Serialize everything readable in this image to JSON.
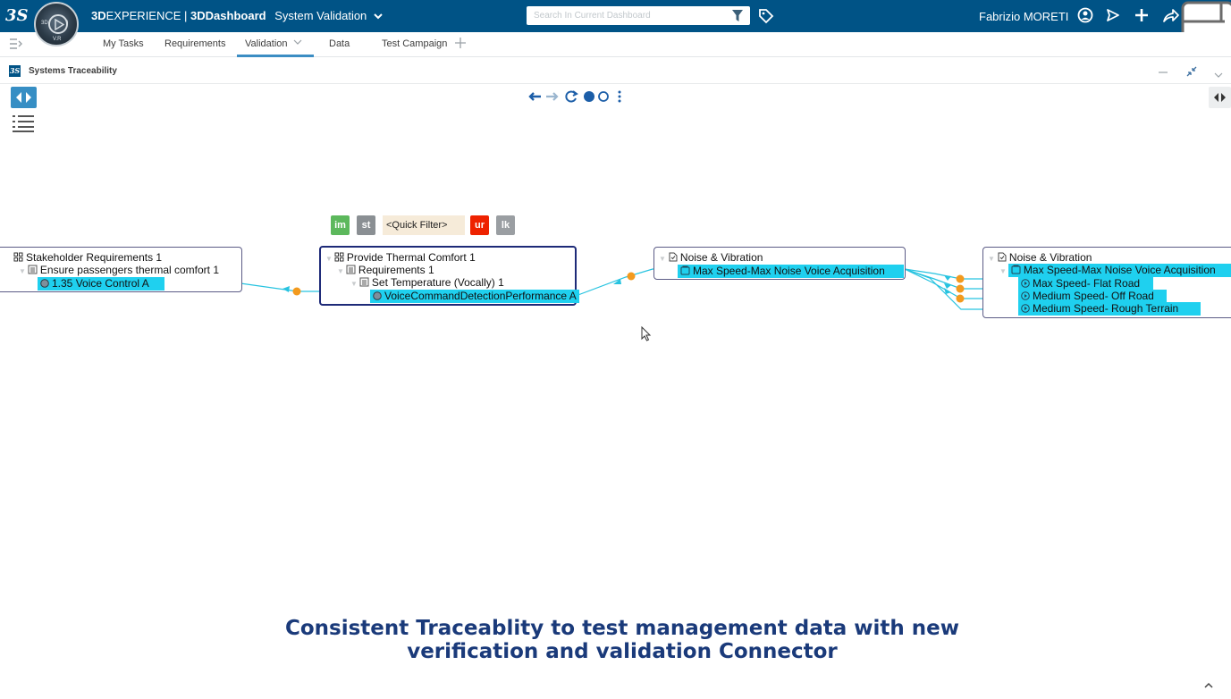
{
  "topbar": {
    "brand_prefix": "3D",
    "brand_experience": "EXPERIENCE",
    "brand_sep": " | ",
    "brand_dashboard": "3DDashboard",
    "dashboard_name": "System Validation",
    "search_placeholder": "Search In Current Dashboard",
    "username": "Fabrizio MORETI",
    "compass_v": "V.R",
    "compass_3d": "3D",
    "compass_i": "i"
  },
  "tabs": {
    "items": [
      {
        "label": "My Tasks"
      },
      {
        "label": "Requirements"
      },
      {
        "label": "Validation"
      },
      {
        "label": "Data"
      },
      {
        "label": "Test Campaign"
      }
    ]
  },
  "widget": {
    "title": "Systems Traceability"
  },
  "quick_filter": {
    "chips": [
      {
        "label": "im",
        "color": "#5cb85c"
      },
      {
        "label": "st",
        "color": "#8a8f93"
      },
      {
        "label": "ur",
        "color": "#ee2200"
      },
      {
        "label": "lk",
        "color": "#9a9ea2"
      }
    ],
    "placeholder": "<Quick Filter>"
  },
  "nodes": {
    "stakeholder": {
      "title": "Stakeholder Requirements 1",
      "child": "Ensure passengers thermal comfort 1",
      "leaf": "1.35 Voice Control A"
    },
    "thermal": {
      "title": "Provide Thermal Comfort 1",
      "child": "Requirements 1",
      "grandchild": "Set Temperature (Vocally) 1",
      "leaf": "VoiceCommandDetectionPerformance A"
    },
    "noise1": {
      "title": "Noise & Vibration",
      "leaf": "Max Speed-Max Noise Voice Acquisition"
    },
    "noise2": {
      "title": "Noise & Vibration",
      "child": "Max Speed-Max Noise Voice Acquisition",
      "leaves": [
        "Max Speed- Flat Road",
        "Medium Speed- Off Road",
        "Medium Speed- Rough Terrain"
      ]
    }
  },
  "colors": {
    "topbar": "#005386",
    "highlight": "#1fd0ef",
    "connector": "#27c3e0",
    "link_dot": "#f39a1e",
    "caption": "#1a3a7a"
  },
  "caption": {
    "line1": "Consistent Traceablity to test management data with new",
    "line2": "verification and validation Connector"
  }
}
